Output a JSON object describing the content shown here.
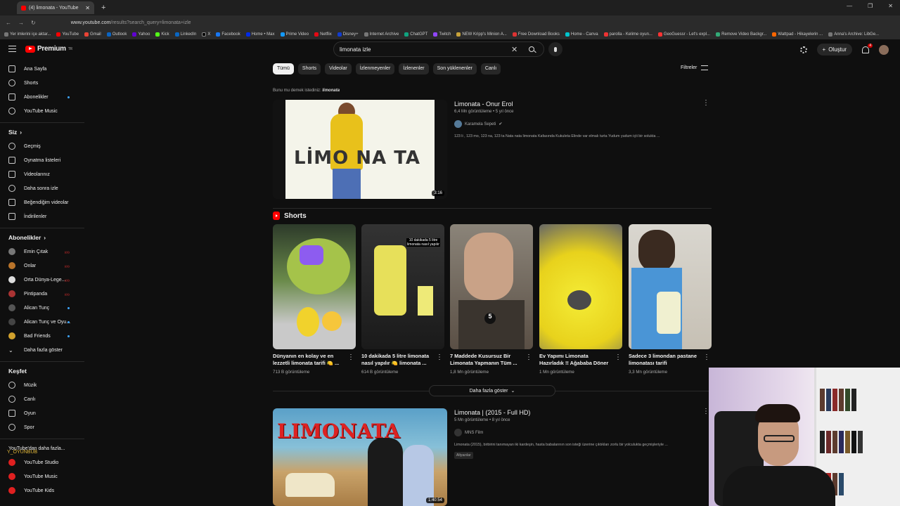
{
  "browser": {
    "tab_title": "(4) limonata - YouTube",
    "url_host": "www.youtube.com",
    "url_path": "/results?search_query=limonata+izle",
    "bookmarks": [
      "Yer imlerini içe aktar...",
      "YouTube",
      "Gmail",
      "Outlook",
      "Yahoo",
      "Kick",
      "LinkedIn",
      "X",
      "Facebook",
      "Home • Max",
      "Prime Video",
      "Netflix",
      "Disney+",
      "Internet Archive",
      "ChatGPT",
      "Twitch",
      "NEW Kripp's Minion A...",
      "Free Download Books",
      "Home - Canva",
      "parolla - Kelime oyun...",
      "GeoGuessr - Let's expl...",
      "Remove Video Backgr...",
      "Wattpad - Hikayelerin ...",
      "Anna's Archive: LibGe..."
    ]
  },
  "header": {
    "logo_text": "Premium",
    "logo_sup": "TR",
    "search_value": "limonata izle",
    "create_label": "Oluştur",
    "notif_count": "4"
  },
  "sidebar": {
    "main": [
      "Ana Sayfa",
      "Shorts",
      "Abonelikler",
      "YouTube Music"
    ],
    "you_heading": "Siz",
    "you_items": [
      "Geçmiş",
      "Oynatma listeleri",
      "Videolarınız",
      "Daha sonra izle",
      "Beğendiğim videolar",
      "İndirilenler"
    ],
    "subs_heading": "Abonelikler",
    "subs_items": [
      "Emin Çıtak",
      "Onlar",
      "Orta Dünya-Lege...",
      "Pintipanda",
      "Alican Tunç",
      "Alican Tunç ve Oyu...",
      "Bad Friends",
      "Daha fazla göster"
    ],
    "explore_heading": "Keşfet",
    "explore_items": [
      "Müzik",
      "Canlı",
      "Oyun",
      "Spor"
    ],
    "more_heading": "YouTube'dan daha fazla...",
    "more_items": [
      "YouTube Studio",
      "YouTube Music",
      "YouTube Kids"
    ],
    "overlay_text": "Y_OYUNBUB"
  },
  "chips": [
    "Tümü",
    "Shorts",
    "Videolar",
    "İzlenmeyenler",
    "İzlenenler",
    "Son yüklenenler",
    "Canlı"
  ],
  "filters_label": "Filtreler",
  "did_you_mean": {
    "prefix": "Bunu mu demek istediniz:",
    "term": "limonata"
  },
  "video1": {
    "thumb_text": "LİMO NA TA",
    "title": "Limonata - Onur Erol",
    "meta": "6,4 Mn görüntüleme • 5 yıl önce",
    "channel": "Karamela Sepeti",
    "desc": "123 li , 123 mo, 123 na, 123 ta Nata nata limonata Kafasında Kukuleta Elinde var elmalı turta Yudum yudum içti bir solukta ...",
    "duration": "3:16"
  },
  "shorts": {
    "heading": "Shorts",
    "items": [
      {
        "title": "Dünyanın en kolay ve en lezzetli limonata tarifi 🍋 ...",
        "views": "713 B görüntüleme"
      },
      {
        "title": "10 dakikada 5 litre limonata nasıl yapılır 🍋 limonata ...",
        "views": "614 B görüntüleme"
      },
      {
        "title": "7 Maddede Kusursuz Bir Limonata Yapmanın Tüm ...",
        "views": "1,8 Mn görüntüleme"
      },
      {
        "title": "Ev Yapımı Limonata Hazırladık !! Ağababa Döner",
        "views": "1 Mn görüntüleme"
      },
      {
        "title": "Sadece 3 limondan pastane limonatası tarifi",
        "views": "3,3 Mn görüntüleme"
      }
    ],
    "overlay_2": "10 dakikada 5 litre limonata nasıl yapılır",
    "overlay_3": "5",
    "more_label": "Daha fazla göster"
  },
  "video2": {
    "thumb_text": "LIMONATA",
    "title": "Limonata | (2015 - Full HD)",
    "meta": "5 Mn görüntüleme • 8 yıl önce",
    "channel": "MNS Film",
    "desc": "Limonata (2015), birbirini tanımayan iki kardeşin, hasta babalarının son isteği üzerine çıktıkları zorlu bir yolculukta geçmişleriyle ...",
    "badge": "Altyazılar",
    "duration": "1:40:54"
  },
  "colors": {
    "accent_red": "#ff0000",
    "background": "#0f0f0f",
    "chip_active": "#f1f1f1"
  }
}
